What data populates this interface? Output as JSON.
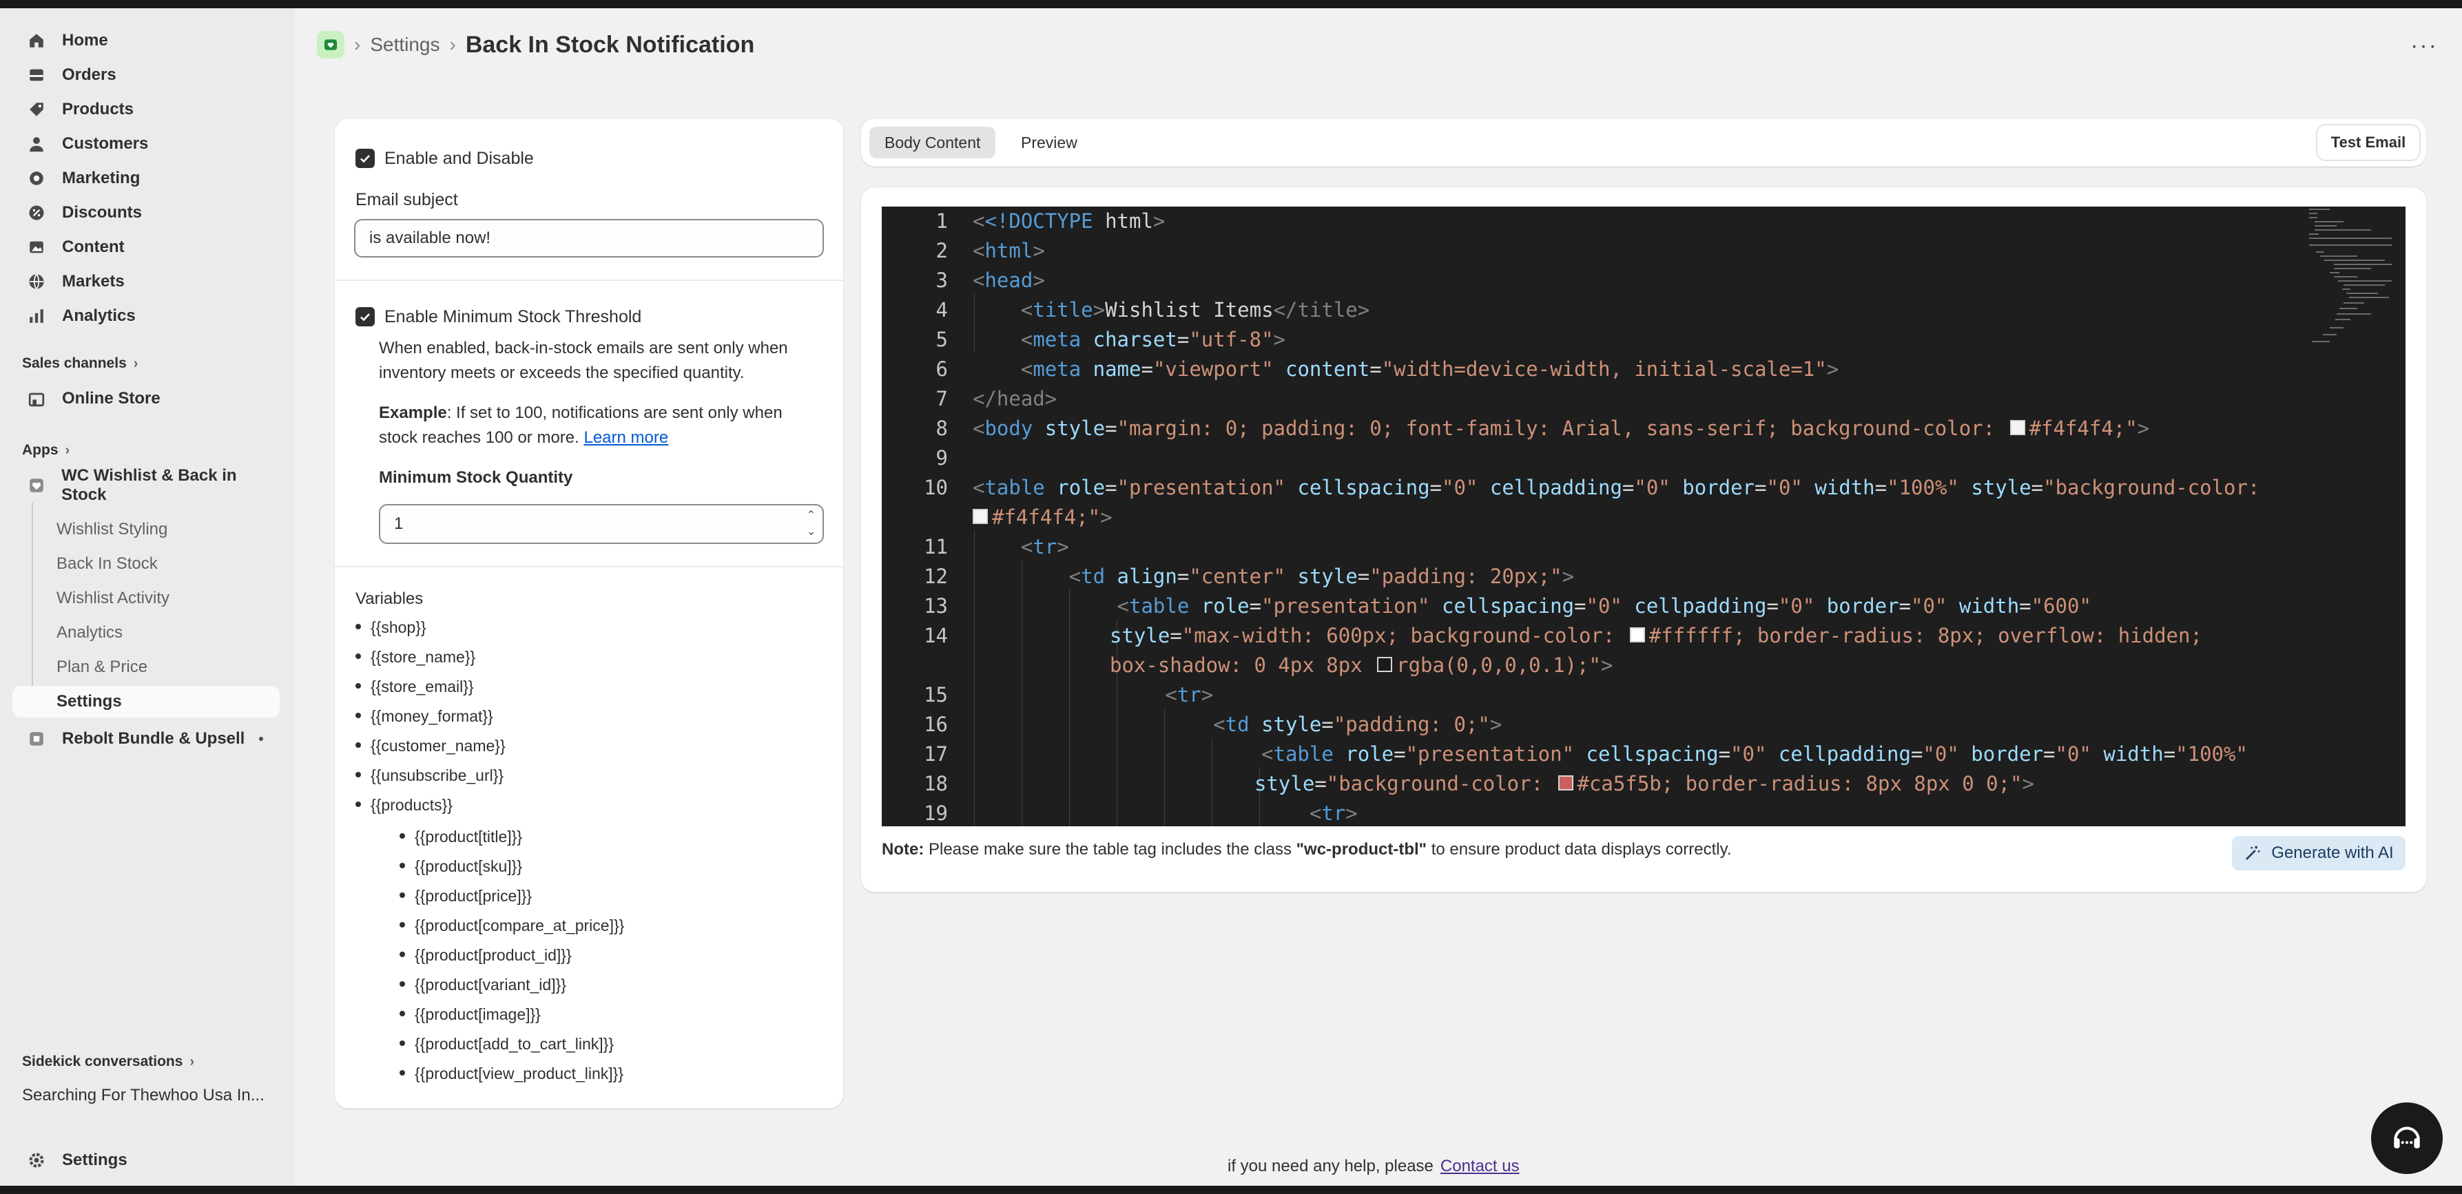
{
  "sidebar": {
    "main_nav": [
      {
        "label": "Home",
        "icon": "home-icon"
      },
      {
        "label": "Orders",
        "icon": "orders-icon"
      },
      {
        "label": "Products",
        "icon": "products-icon"
      },
      {
        "label": "Customers",
        "icon": "customers-icon"
      },
      {
        "label": "Marketing",
        "icon": "marketing-icon"
      },
      {
        "label": "Discounts",
        "icon": "discounts-icon"
      },
      {
        "label": "Content",
        "icon": "content-icon"
      },
      {
        "label": "Markets",
        "icon": "markets-icon"
      },
      {
        "label": "Analytics",
        "icon": "analytics-icon"
      }
    ],
    "sales_channels_label": "Sales channels",
    "online_store_label": "Online Store",
    "apps_label": "Apps",
    "app_name": "WC Wishlist & Back in Stock",
    "app_subnav": [
      "Wishlist Styling",
      "Back In Stock",
      "Wishlist Activity",
      "Analytics",
      "Plan & Price",
      "Settings"
    ],
    "second_app": "Rebolt Bundle & Upsell",
    "sidekick_label": "Sidekick conversations",
    "sidekick_item": "Searching For Thewhoo Usa In...",
    "settings_label": "Settings"
  },
  "header": {
    "crumb_settings": "Settings",
    "separator": "›",
    "page_title": "Back In Stock Notification",
    "more_label": "···"
  },
  "form": {
    "enable_label": "Enable and Disable",
    "email_subject_label": "Email subject",
    "email_subject_value": "is available now!",
    "threshold_label": "Enable Minimum Stock Threshold",
    "threshold_desc_1": "When enabled, back-in-stock emails are sent only when",
    "threshold_desc_2": "inventory meets or exceeds the specified quantity.",
    "example_bold": "Example",
    "example_text_1": ": If set to 100, notifications are sent only when",
    "example_text_2": "stock reaches 100 or more.",
    "learn_more": "Learn more",
    "min_qty_label": "Minimum Stock Quantity",
    "min_qty_value": "1",
    "variables_label": "Variables",
    "variables": [
      "{{shop}}",
      "{{store_name}}",
      "{{store_email}}",
      "{{money_format}}",
      "{{customer_name}}",
      "{{unsubscribe_url}}",
      "{{products}}"
    ],
    "product_variables": [
      "{{product[title]}}",
      "{{product[sku]}}",
      "{{product[price]}}",
      "{{product[compare_at_price]}}",
      "{{product[product_id]}}",
      "{{product[variant_id]}}",
      "{{product[image]}}",
      "{{product[add_to_cart_link]}}",
      "{{product[view_product_link]}}"
    ]
  },
  "tabs": {
    "body_content": "Body Content",
    "preview": "Preview",
    "test_email": "Test Email"
  },
  "editor": {
    "line_numbers": [
      "1",
      "2",
      "3",
      "4",
      "5",
      "6",
      "7",
      "8",
      "9",
      "10",
      "11",
      "12",
      "13",
      "14",
      "15",
      "16",
      "17",
      "18",
      "19"
    ],
    "colors": {
      "swatch1": "#f4f4f4",
      "swatch2": "#f4f4f4",
      "swatch3": "#ffffff",
      "swatch4": "rgba(0,0,0,0.1)",
      "swatch5": "#ca5f5b"
    },
    "lines": {
      "l1a": "<!DOCTYPE",
      "l1b": " html",
      "l1c": ">",
      "l2": "html",
      "l3": "head",
      "l4_tag": "title",
      "l4_text": "Wishlist Items",
      "l4_close": "</title>",
      "l5_tag": "meta",
      "l5_attr": "charset",
      "l5_val": "\"utf-8\"",
      "l6_tag": "meta",
      "l6_attr1": "name",
      "l6_val1": "\"viewport\"",
      "l6_attr2": "content",
      "l6_val2": "\"width=device-width, initial-scale=1\"",
      "l7": "</head>",
      "l8_tag": "body",
      "l8_attr": "style",
      "l8_val": "\"margin: 0; padding: 0; font-family: Arial, sans-serif; background-color: ",
      "l8_color": "#f4f4f4;\"",
      "l10_tag": "table",
      "l10_a1": "role",
      "l10_v1": "\"presentation\"",
      "l10_a2": "cellspacing",
      "l10_v2": "\"0\"",
      "l10_a3": "cellpadding",
      "l10_v3": "\"0\"",
      "l10_a4": "border",
      "l10_v4": "\"0\"",
      "l10_a5": "width",
      "l10_v5": "\"100%\"",
      "l10_a6": "style",
      "l10_v6": "\"background-color:",
      "l10_wrap": "#f4f4f4;\"",
      "l11": "tr",
      "l12_tag": "td",
      "l12_a1": "align",
      "l12_v1": "\"center\"",
      "l12_a2": "style",
      "l12_v2": "\"padding: 20px;\"",
      "l13_tag": "table",
      "l13_a1": "role",
      "l13_v1": "\"presentation\"",
      "l13_a2": "cellspacing",
      "l13_v2": "\"0\"",
      "l13_a3": "cellpadding",
      "l13_v3": "\"0\"",
      "l13_a4": "border",
      "l13_v4": "\"0\"",
      "l13_a5": "width",
      "l13_v5": "\"600\"",
      "l14_attr": "style",
      "l14_val": "\"max-width: 600px; background-color: ",
      "l14_val2": "#ffffff; border-radius: 8px; overflow: hidden;",
      "l14_wrap": "box-shadow: 0 4px 8px ",
      "l14_wrap2": "rgba(0,0,0,0.1);\"",
      "l15": "tr",
      "l16_tag": "td",
      "l16_attr": "style",
      "l16_val": "\"padding: 0;\"",
      "l17_tag": "table",
      "l17_a1": "role",
      "l17_v1": "\"presentation\"",
      "l17_a2": "cellspacing",
      "l17_v2": "\"0\"",
      "l17_a3": "cellpadding",
      "l17_v3": "\"0\"",
      "l17_a4": "border",
      "l17_v4": "\"0\"",
      "l17_a5": "width",
      "l17_v5": "\"100%\"",
      "l18_attr": "style",
      "l18_val": "\"background-color: ",
      "l18_val2": "#ca5f5b; border-radius: 8px 8px 0 0;\"",
      "l19": "tr"
    }
  },
  "note": {
    "bold": "Note:",
    "text": " Please make sure the table tag includes the class ",
    "class_name": "\"wc-product-tbl\"",
    "text2": " to ensure product data displays correctly."
  },
  "ai_button": "Generate with AI",
  "footer": {
    "text": "if you need any help, please",
    "link": "Contact us"
  }
}
